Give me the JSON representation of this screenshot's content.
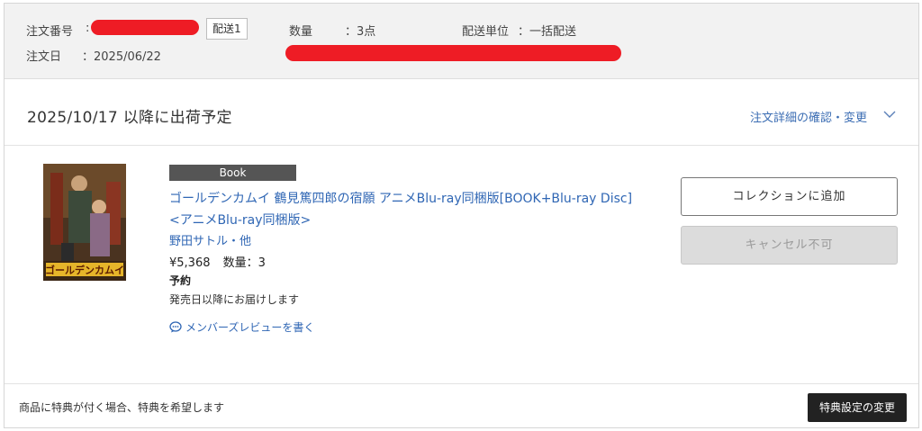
{
  "header": {
    "order_number_label": "注文番号",
    "colon": ":",
    "shipment_badge": "配送1",
    "quantity_label": "数量",
    "quantity_value": "：3点",
    "shipping_unit_label": "配送単位",
    "shipping_unit_value": "：一括配送",
    "order_date_label": "注文日",
    "order_date_value": "：2025/06/22",
    "redaction_color": "#ee1c25"
  },
  "shipment": {
    "date": "2025/10/17",
    "date_suffix": "以降に出荷予定",
    "details_link": "注文詳細の確認・変更",
    "toggle_icon": "chevron-down-icon"
  },
  "item": {
    "category_badge": "Book",
    "title_line1": "ゴールデンカムイ 鶴見篤四郎の宿願 アニメBlu-ray同梱版[BOOK+Blu-ray Disc]",
    "title_line2": "<アニメBlu-ray同梱版>",
    "author": "野田サトル・他",
    "price": "¥5,368",
    "quantity": "数量：3",
    "status": "予約",
    "delivery_note": "発売日以降にお届けします",
    "review_link": "メンバーズレビューを書く",
    "review_icon": "speech-bubble-icon",
    "cover_logo_text": "ゴールデンカムイ"
  },
  "actions": {
    "add_collection": "コレクションに追加",
    "cancel_disabled": "キャンセル不可"
  },
  "footer": {
    "bonus_text": "商品に特典が付く場合、特典を希望します",
    "bonus_button": "特典設定の変更"
  },
  "colors": {
    "link": "#2f66b4",
    "header_bg": "#f2f2f2",
    "badge_bg": "#555555",
    "footer_button_bg": "#222222"
  }
}
